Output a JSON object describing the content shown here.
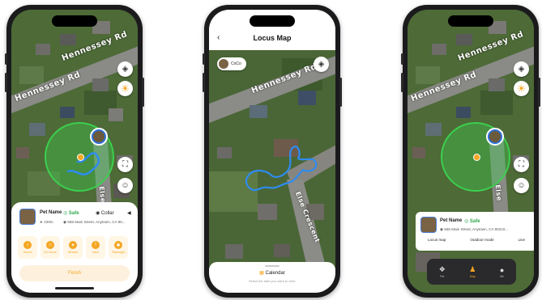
{
  "colors": {
    "accent": "#f5a623",
    "safe": "#2fa84f",
    "geofence": "#3ccf4e",
    "track": "#2e8cf0",
    "frame": "#1b1b1d"
  },
  "phone1": {
    "road_top": "Hennessey Rd",
    "road_left": "Hennessey Rd",
    "road_side": "Else",
    "pet_name": "Pet Name",
    "safe_label": "Safe",
    "collar_label": "Collar",
    "distance": "100m",
    "address": "555 Main Street, Anytown, CA 90...",
    "actions": [
      {
        "label": "Sound",
        "icon": "bell-icon"
      },
      {
        "label": "Go home",
        "icon": "home-icon"
      },
      {
        "label": "Whistle",
        "icon": "whistle-icon"
      },
      {
        "label": "Alert",
        "icon": "alert-icon"
      },
      {
        "label": "Flashlight",
        "icon": "flashlight-icon"
      }
    ],
    "finish_label": "Finish"
  },
  "phone2": {
    "title": "Locus Map",
    "pet_chip": "CoCo",
    "street": "Else Crescent",
    "panel_title": "Calendar",
    "panel_sub": "Select the date you want to view."
  },
  "phone3": {
    "road_top": "Hennessey Rd",
    "road_left": "Hennessey Rd",
    "road_side": "Else",
    "pet_name": "Pet Name",
    "safe_label": "Safe",
    "address": "555 Main Street, Anytown, CA 90210...",
    "modes": [
      "Locus map",
      "Outdoor mode",
      "Live"
    ],
    "tabs": [
      {
        "label": "Pet",
        "icon": "paw-icon"
      },
      {
        "label": "Map",
        "icon": "person-icon"
      },
      {
        "label": "Me",
        "icon": "profile-icon"
      }
    ]
  }
}
